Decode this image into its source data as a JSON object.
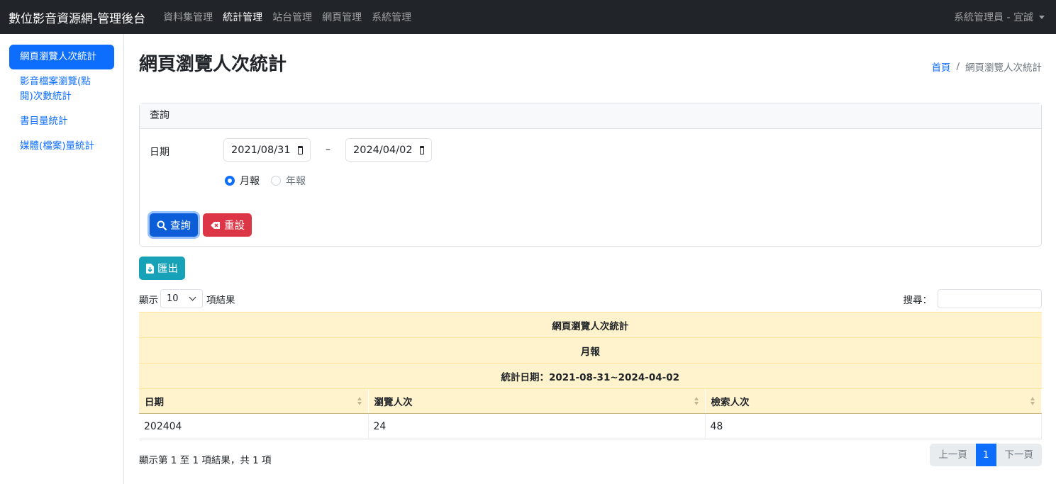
{
  "navbar": {
    "brand": "數位影音資源網-管理後台",
    "links": [
      "資料集管理",
      "統計管理",
      "站台管理",
      "網頁管理",
      "系統管理"
    ],
    "active": "統計管理",
    "user": "系統管理員 - 宜誠"
  },
  "sidebar": {
    "items": [
      "網頁瀏覽人次統計",
      "影音檔案瀏覽(點閱)次數統計",
      "書目量統計",
      "媒體(檔案)量統計"
    ]
  },
  "page": {
    "title": "網頁瀏覽人次統計",
    "breadcrumb": {
      "home": "首頁",
      "separator": "/",
      "current": "網頁瀏覽人次統計"
    }
  },
  "query": {
    "header": "查詢",
    "date_label": "日期",
    "start_date": "2021/08/31",
    "date_separator": "–",
    "end_date": "2024/04/02",
    "radio_monthly": "月報",
    "radio_yearly": "年報",
    "selected": "月報",
    "search_button": "查詢",
    "reset_button": "重設"
  },
  "export_button": "匯出",
  "length": {
    "prefix": "顯示",
    "value": "10",
    "suffix": "項結果"
  },
  "search": {
    "label": "搜尋：",
    "value": ""
  },
  "table": {
    "title": "網頁瀏覽人次統計",
    "subtitle": "月報",
    "range": "統計日期：2021-08-31~2024-04-02",
    "columns": [
      "日期",
      "瀏覽人次",
      "檢索人次"
    ],
    "rows": [
      [
        "202404",
        "24",
        "48"
      ]
    ]
  },
  "footer": {
    "info": "顯示第 1 至 1 項結果，共 1 項",
    "prev": "上一頁",
    "page": "1",
    "next": "下一頁"
  },
  "colors": {
    "primary": "#0d6efd",
    "danger": "#dc3545",
    "info": "#17a2b8",
    "navbar": "#212529",
    "table_header": "#fff3cd"
  }
}
